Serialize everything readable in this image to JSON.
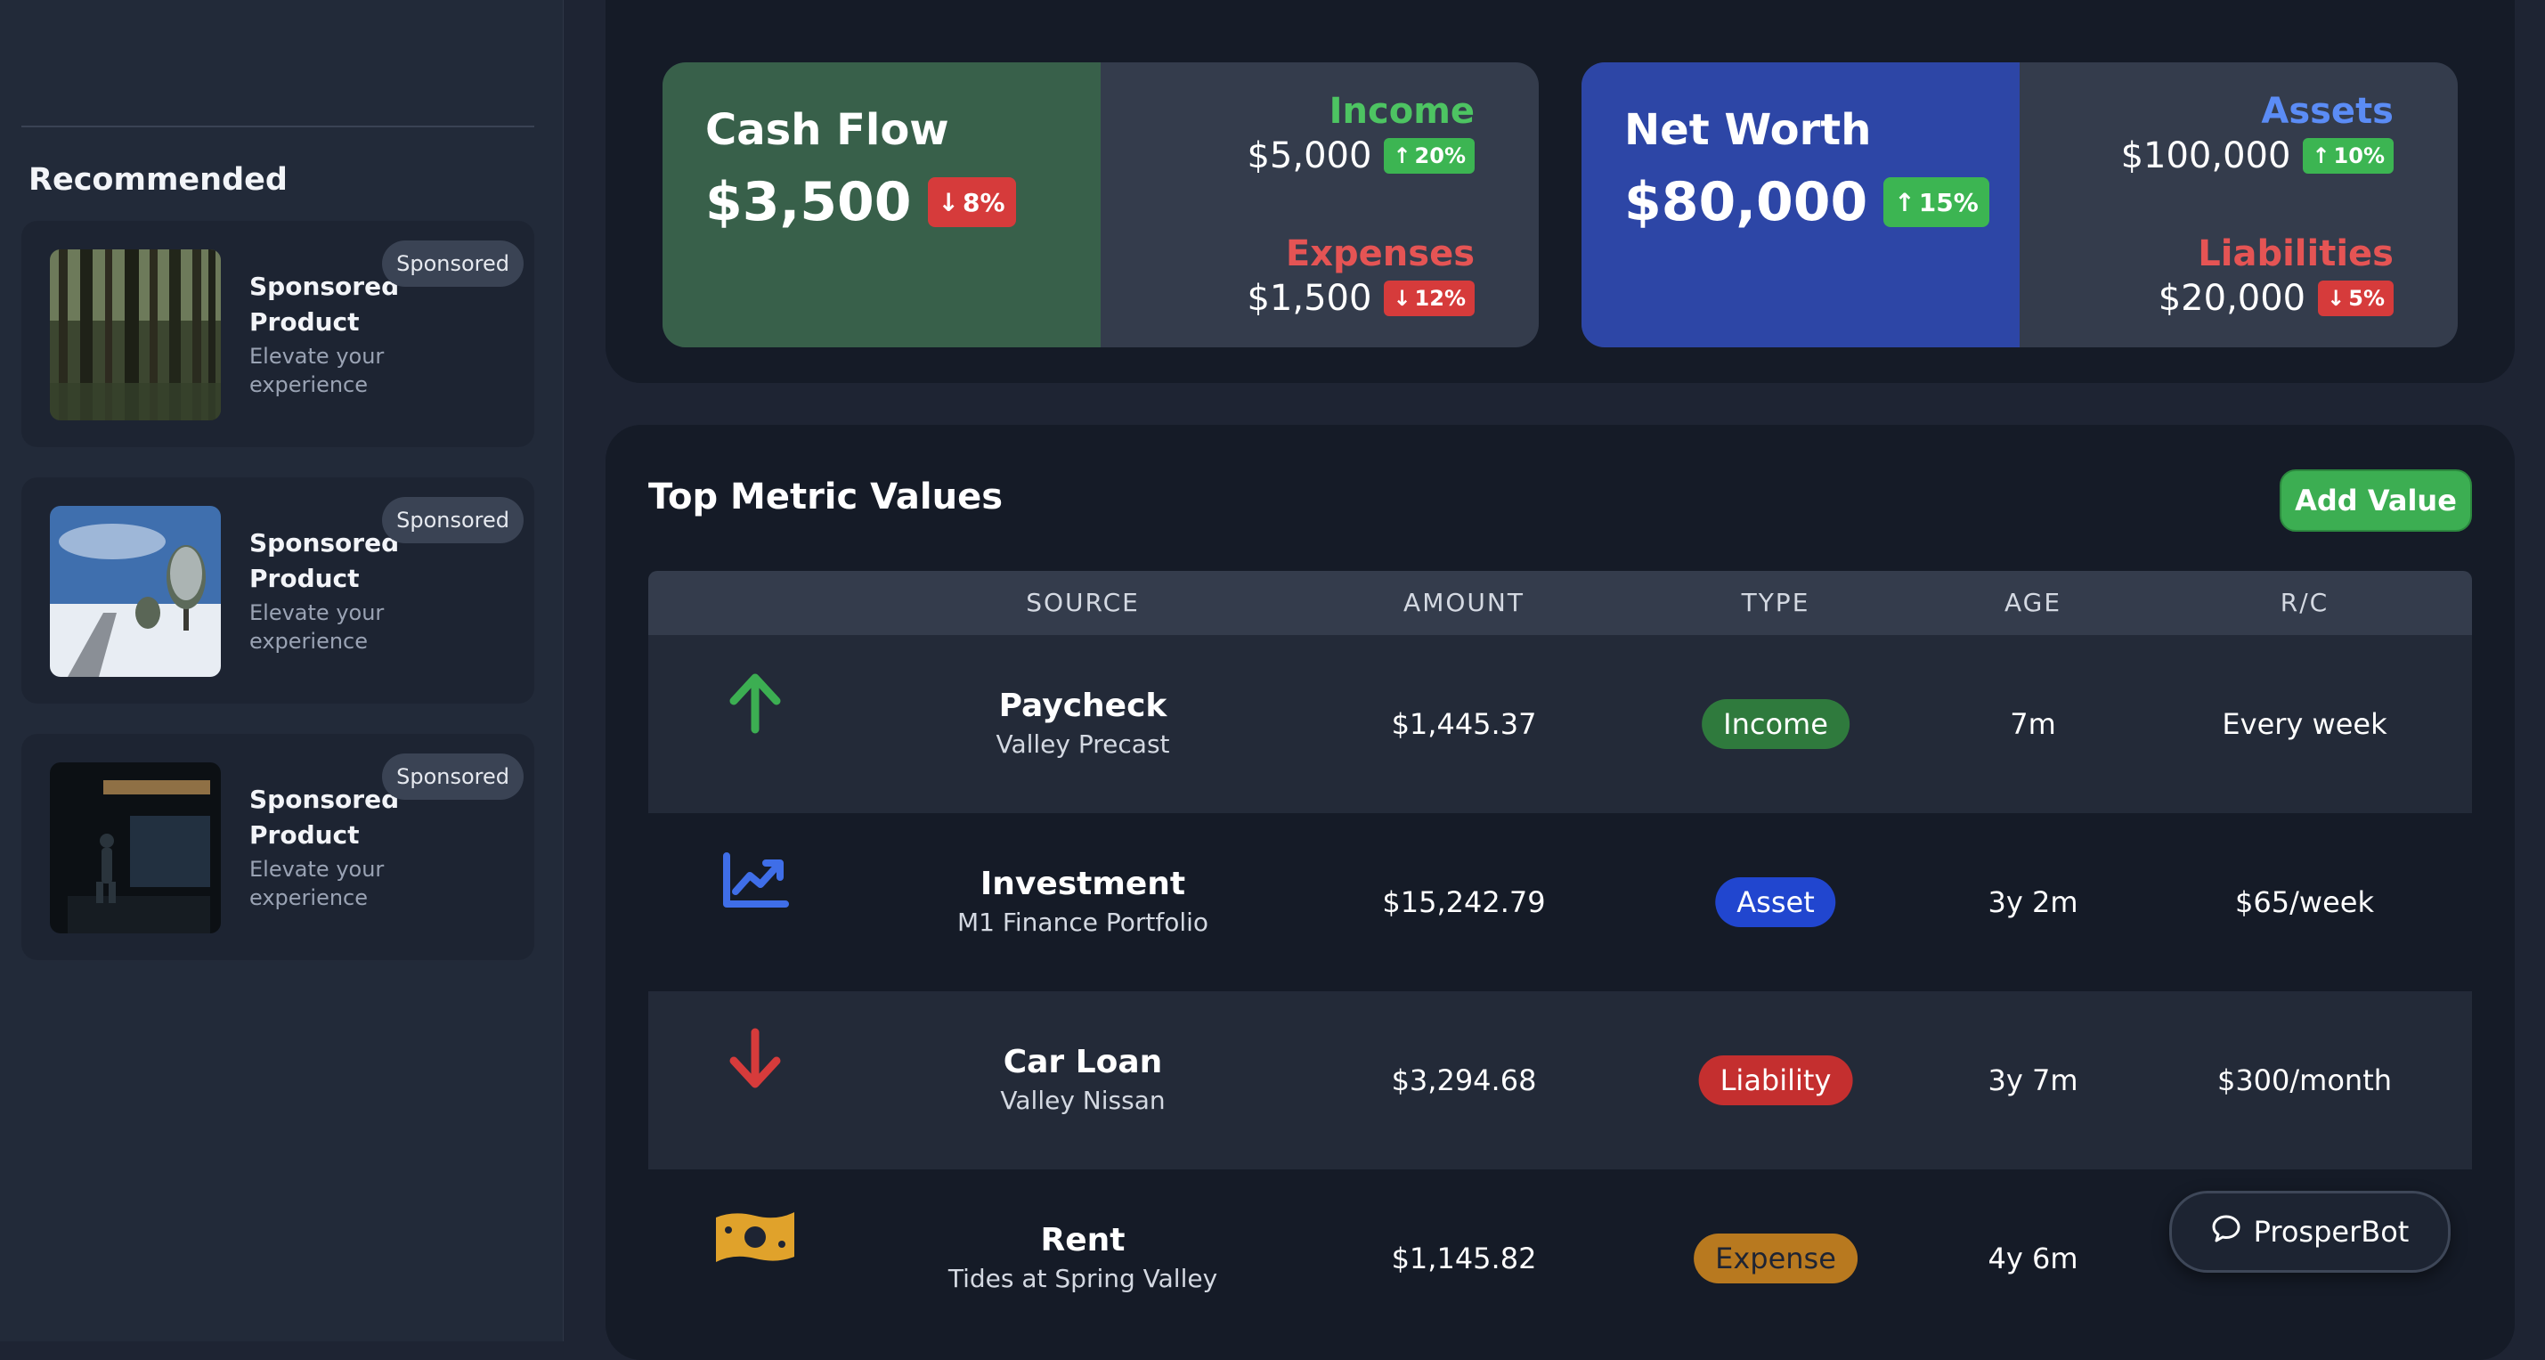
{
  "sidebar": {
    "recommended_title": "Recommended",
    "promos": [
      {
        "name": "Sponsored Product",
        "description": "Elevate your experience",
        "badge": "Sponsored",
        "image": "forest"
      },
      {
        "name": "Sponsored Product",
        "description": "Elevate your experience",
        "badge": "Sponsored",
        "image": "snow-boardwalk"
      },
      {
        "name": "Sponsored Product",
        "description": "Elevate your experience",
        "badge": "Sponsored",
        "image": "tunnel-silhouette"
      }
    ]
  },
  "cash_flow": {
    "title": "Cash Flow",
    "value": "$3,500",
    "change": "8%",
    "change_dir": "down",
    "income_label": "Income",
    "income_value": "$5,000",
    "income_change": "20%",
    "expenses_label": "Expenses",
    "expenses_value": "$1,500",
    "expenses_change": "12%"
  },
  "net_worth": {
    "title": "Net Worth",
    "value": "$80,000",
    "change": "15%",
    "change_dir": "up",
    "assets_label": "Assets",
    "assets_value": "$100,000",
    "assets_change": "10%",
    "liabilities_label": "Liabilities",
    "liabilities_value": "$20,000",
    "liabilities_change": "5%"
  },
  "metrics": {
    "title": "Top Metric Values",
    "add_button": "Add Value",
    "columns": [
      "SOURCE",
      "AMOUNT",
      "TYPE",
      "AGE",
      "R/C"
    ],
    "rows": [
      {
        "icon": "arrow-up-icon",
        "name": "Paycheck",
        "sub": "Valley Precast",
        "amount": "$1,445.37",
        "type": "Income",
        "age": "7m",
        "rc": "Every week"
      },
      {
        "icon": "trending-up-icon",
        "name": "Investment",
        "sub": "M1 Finance Portfolio",
        "amount": "$15,242.79",
        "type": "Asset",
        "age": "3y 2m",
        "rc": "$65/week"
      },
      {
        "icon": "arrow-down-icon",
        "name": "Car Loan",
        "sub": "Valley Nissan",
        "amount": "$3,294.68",
        "type": "Liability",
        "age": "3y 7m",
        "rc": "$300/month"
      },
      {
        "icon": "money-bill-icon",
        "name": "Rent",
        "sub": "Tides at Spring Valley",
        "amount": "$1,145.82",
        "type": "Expense",
        "age": "4y 6m",
        "rc": ""
      }
    ]
  },
  "chat": {
    "label": "ProsperBot"
  },
  "colors": {
    "cash_flow_bg": "#38604a",
    "net_worth_bg": "#2d46a6",
    "income_green": "#4dc462",
    "expense_red": "#e55454",
    "assets_blue": "#5b8cf5",
    "type_income": "#2f7a3d",
    "type_asset": "#2146cf",
    "type_liability": "#c42f2f",
    "type_expense": "#b8791f"
  }
}
